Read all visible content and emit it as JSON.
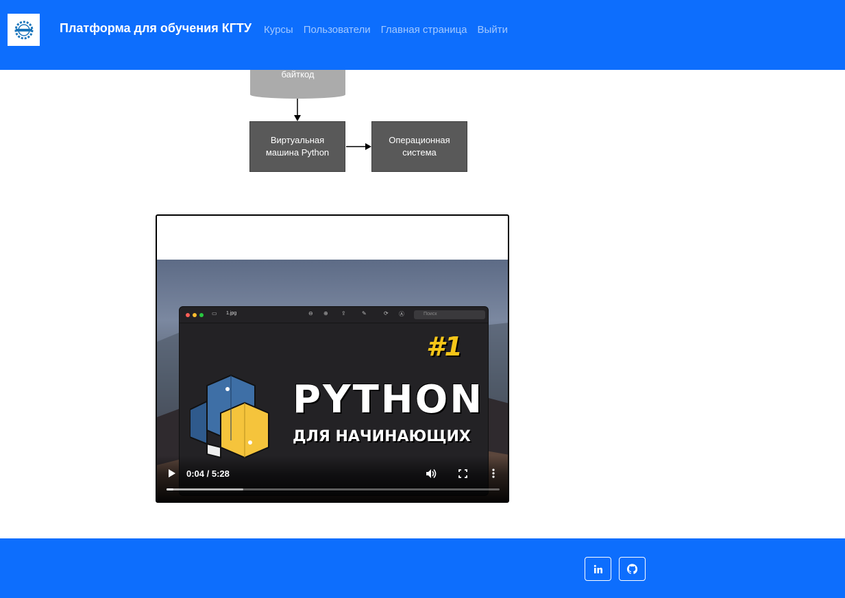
{
  "navbar": {
    "brand": "Платформа для обучения КГТУ",
    "links": [
      {
        "label": "Курсы"
      },
      {
        "label": "Пользователи"
      },
      {
        "label": "Главная страница"
      },
      {
        "label": "Выйти"
      }
    ]
  },
  "diagram": {
    "bytecode_label": "байткод",
    "vm_label": "Виртуальная машина Python",
    "os_label": "Операционная система"
  },
  "video": {
    "thumbnail": {
      "file_name": "1.jpg",
      "search_placeholder": "Поиск",
      "episode": "#1",
      "title": "PYTHON",
      "subtitle": "ДЛЯ НАЧИНАЮЩИХ"
    },
    "time": "0:04 / 5:28",
    "progress_played_fraction": 0.0125,
    "progress_buffered_fraction": 0.23,
    "icons": [
      "play-icon",
      "volume-icon",
      "fullscreen-icon",
      "more-options-icon"
    ]
  },
  "footer": {
    "social": [
      {
        "name": "linkedin-icon"
      },
      {
        "name": "github-icon"
      }
    ]
  },
  "colors": {
    "primary": "#0d6efd",
    "diagram_box": "#595959",
    "diagram_cylinder": "#ababab",
    "python_blue": "#3e6fa6",
    "python_yellow": "#f5c43c"
  }
}
